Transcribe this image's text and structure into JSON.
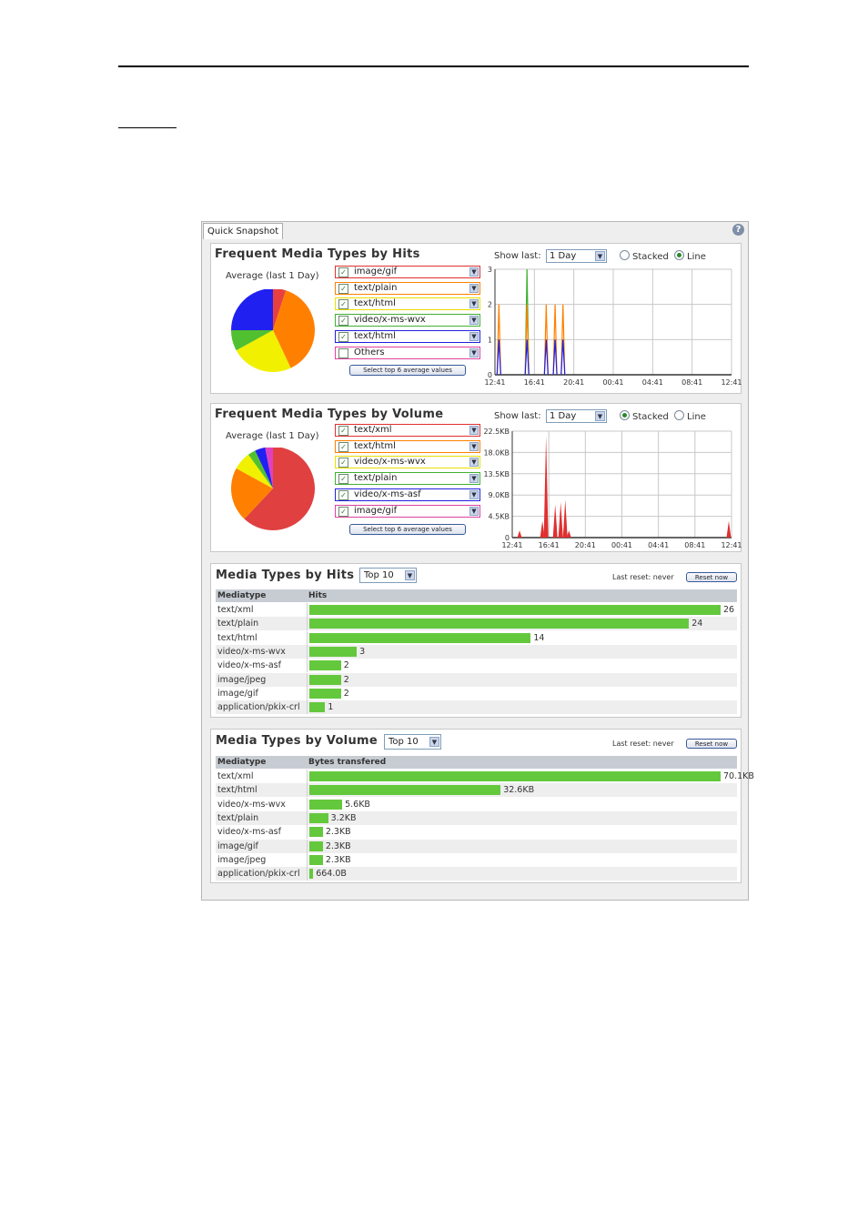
{
  "window": {
    "tab": "Quick Snapshot",
    "help_icon": "?"
  },
  "hits_panel": {
    "title": "Frequent Media Types by Hits",
    "average_label": "Average (last 1 Day)",
    "pie": [
      {
        "label": "image/gif",
        "color": "#e84040",
        "value": 5
      },
      {
        "label": "text/plain",
        "color": "#ff8000",
        "value": 38
      },
      {
        "label": "text/html",
        "color": "#f0f000",
        "value": 24
      },
      {
        "label": "video/x-ms-wvx",
        "color": "#50c030",
        "value": 8
      },
      {
        "label": "text/html",
        "color": "#2020f0",
        "value": 25
      }
    ],
    "selectors": [
      {
        "label": "image/gif",
        "checked": true,
        "color": "#e03030"
      },
      {
        "label": "text/plain",
        "checked": true,
        "color": "#ff8000"
      },
      {
        "label": "text/html",
        "checked": true,
        "color": "#e8e000"
      },
      {
        "label": "video/x-ms-wvx",
        "checked": true,
        "color": "#40b030"
      },
      {
        "label": "text/html",
        "checked": true,
        "color": "#2020e0"
      },
      {
        "label": "Others",
        "checked": false,
        "color": "#e040a0"
      }
    ],
    "select_button": "Select top 6 average values",
    "show_last_label": "Show last:",
    "show_last_value": "1 Day",
    "stacked_label": "Stacked",
    "line_label": "Line",
    "mode": "Line",
    "chart_data": {
      "type": "line",
      "x_ticks": [
        "12:41",
        "16:41",
        "20:41",
        "00:41",
        "04:41",
        "08:41",
        "12:41"
      ],
      "y_ticks": [
        "0",
        "1",
        "2",
        "3"
      ],
      "ylim": [
        0,
        3
      ],
      "spikes": [
        {
          "x": 0.4,
          "series": "text/plain",
          "color": "#ff8000",
          "value": 2
        },
        {
          "x": 0.4,
          "series": "text/html",
          "color": "#2020e0",
          "value": 1
        },
        {
          "x": 3.25,
          "series": "video/x-ms-wvx",
          "color": "#40b030",
          "value": 3
        },
        {
          "x": 3.25,
          "series": "text/plain",
          "color": "#ff8000",
          "value": 2
        },
        {
          "x": 3.25,
          "series": "text/html",
          "color": "#2020e0",
          "value": 1
        },
        {
          "x": 5.2,
          "series": "text/plain",
          "color": "#ff8000",
          "value": 2
        },
        {
          "x": 5.2,
          "series": "text/html",
          "color": "#2020e0",
          "value": 1
        },
        {
          "x": 6.1,
          "series": "text/plain",
          "color": "#ff8000",
          "value": 2
        },
        {
          "x": 6.1,
          "series": "text/html",
          "color": "#2020e0",
          "value": 1
        },
        {
          "x": 6.9,
          "series": "text/plain",
          "color": "#ff8000",
          "value": 2
        },
        {
          "x": 6.9,
          "series": "text/html",
          "color": "#2020e0",
          "value": 1
        }
      ]
    }
  },
  "volume_panel": {
    "title": "Frequent Media Types by Volume",
    "average_label": "Average (last 1 Day)",
    "pie": [
      {
        "label": "text/xml",
        "color": "#e04040",
        "value": 62
      },
      {
        "label": "text/html",
        "color": "#ff8000",
        "value": 21
      },
      {
        "label": "video/x-ms-wvx",
        "color": "#f0f000",
        "value": 7
      },
      {
        "label": "text/plain",
        "color": "#50c030",
        "value": 3
      },
      {
        "label": "video/x-ms-asf",
        "color": "#2020f0",
        "value": 4
      },
      {
        "label": "image/gif",
        "color": "#e040c0",
        "value": 3
      }
    ],
    "selectors": [
      {
        "label": "text/xml",
        "checked": true,
        "color": "#e03030"
      },
      {
        "label": "text/html",
        "checked": true,
        "color": "#ff8000"
      },
      {
        "label": "video/x-ms-wvx",
        "checked": true,
        "color": "#e8e000"
      },
      {
        "label": "text/plain",
        "checked": true,
        "color": "#40b030"
      },
      {
        "label": "video/x-ms-asf",
        "checked": true,
        "color": "#2020e0"
      },
      {
        "label": "image/gif",
        "checked": true,
        "color": "#e040a0"
      }
    ],
    "select_button": "Select top 6 average values",
    "show_last_label": "Show last:",
    "show_last_value": "1 Day",
    "stacked_label": "Stacked",
    "line_label": "Line",
    "mode": "Stacked",
    "chart_data": {
      "type": "area",
      "x_ticks": [
        "12:41",
        "16:41",
        "20:41",
        "00:41",
        "04:41",
        "08:41",
        "12:41"
      ],
      "y_ticks": [
        "0",
        "4.5KB",
        "9.0KB",
        "13.5KB",
        "18.0KB",
        "22.5KB"
      ],
      "ylim_kb": [
        0,
        22.5
      ],
      "spikes": [
        {
          "x": 0.8,
          "kb": 1.5,
          "colors": [
            "#ff8000",
            "#e03030"
          ]
        },
        {
          "x": 3.3,
          "kb": 3.5,
          "colors": [
            "#f0e000",
            "#e03030"
          ]
        },
        {
          "x": 3.7,
          "kb": 21.5,
          "colors": [
            "#ff8000",
            "#e03030"
          ]
        },
        {
          "x": 4.7,
          "kb": 7.0,
          "colors": [
            "#ff8000",
            "#e03030"
          ]
        },
        {
          "x": 5.3,
          "kb": 7.5,
          "colors": [
            "#f0e000",
            "#e03030"
          ]
        },
        {
          "x": 5.8,
          "kb": 8.0,
          "colors": [
            "#ff8000",
            "#e03030"
          ]
        },
        {
          "x": 6.2,
          "kb": 1.5,
          "colors": [
            "#2020e0",
            "#e03030"
          ]
        },
        {
          "x": 23.7,
          "kb": 3.5,
          "colors": [
            "#e03030"
          ]
        }
      ]
    }
  },
  "hits_table": {
    "title": "Media Types by Hits",
    "top_select": "Top 10",
    "last_reset": "Last reset: never",
    "reset_button": "Reset now",
    "col_type": "Mediatype",
    "col_value": "Hits",
    "max": 26,
    "rows": [
      {
        "name": "text/xml",
        "value": 26,
        "label": "26"
      },
      {
        "name": "text/plain",
        "value": 24,
        "label": "24"
      },
      {
        "name": "text/html",
        "value": 14,
        "label": "14"
      },
      {
        "name": "video/x-ms-wvx",
        "value": 3,
        "label": "3"
      },
      {
        "name": "video/x-ms-asf",
        "value": 2,
        "label": "2"
      },
      {
        "name": "image/jpeg",
        "value": 2,
        "label": "2"
      },
      {
        "name": "image/gif",
        "value": 2,
        "label": "2"
      },
      {
        "name": "application/pkix-crl",
        "value": 1,
        "label": "1"
      }
    ]
  },
  "volume_table": {
    "title": "Media Types by Volume",
    "top_select": "Top 10",
    "last_reset": "Last reset: never",
    "reset_button": "Reset now",
    "col_type": "Mediatype",
    "col_value": "Bytes transfered",
    "max": 70.1,
    "rows": [
      {
        "name": "text/xml",
        "value": 70.1,
        "label": "70.1KB"
      },
      {
        "name": "text/html",
        "value": 32.6,
        "label": "32.6KB"
      },
      {
        "name": "video/x-ms-wvx",
        "value": 5.6,
        "label": "5.6KB"
      },
      {
        "name": "text/plain",
        "value": 3.2,
        "label": "3.2KB"
      },
      {
        "name": "video/x-ms-asf",
        "value": 2.3,
        "label": "2.3KB"
      },
      {
        "name": "image/gif",
        "value": 2.3,
        "label": "2.3KB"
      },
      {
        "name": "image/jpeg",
        "value": 2.3,
        "label": "2.3KB"
      },
      {
        "name": "application/pkix-crl",
        "value": 0.65,
        "label": "664.0B"
      }
    ]
  }
}
